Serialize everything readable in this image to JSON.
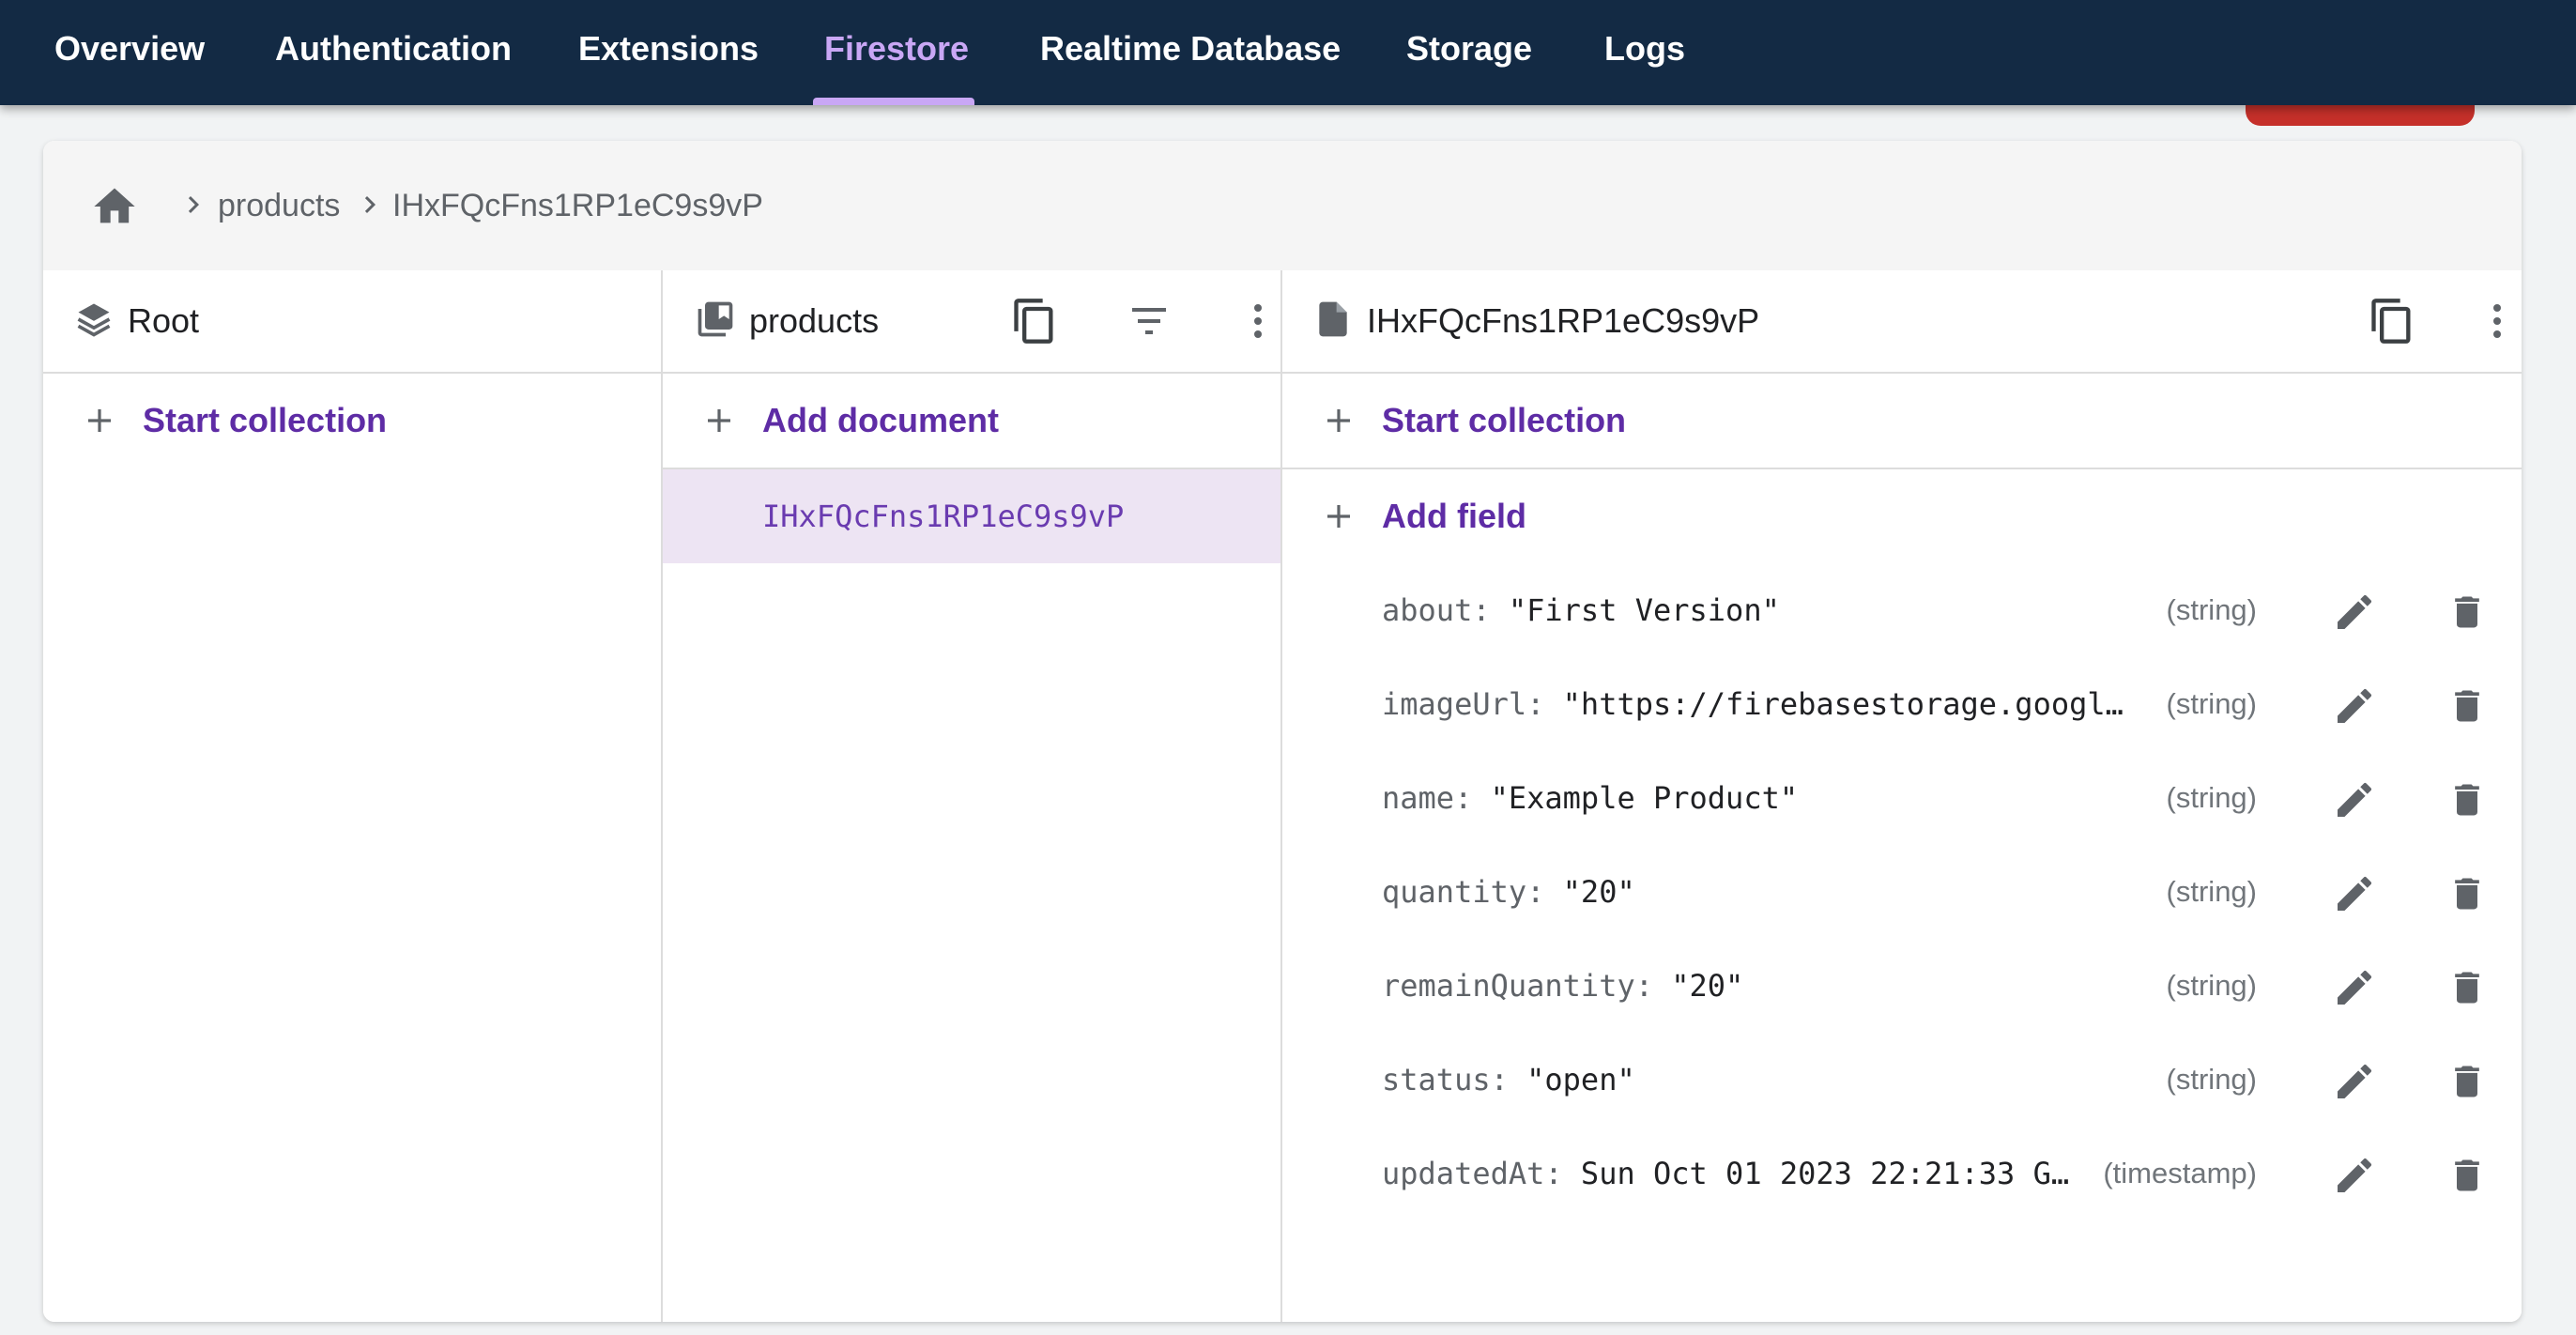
{
  "nav": {
    "tabs": [
      "Overview",
      "Authentication",
      "Extensions",
      "Firestore",
      "Realtime Database",
      "Storage",
      "Logs"
    ],
    "active": "Firestore"
  },
  "breadcrumb": {
    "items": [
      "products",
      "IHxFQcFns1RP1eC9s9vP"
    ]
  },
  "root_column": {
    "title": "Root",
    "start_collection_label": "Start collection"
  },
  "collection_column": {
    "title": "products",
    "add_document_label": "Add document",
    "documents": [
      "IHxFQcFns1RP1eC9s9vP"
    ]
  },
  "document_column": {
    "title": "IHxFQcFns1RP1eC9s9vP",
    "start_collection_label": "Start collection",
    "add_field_label": "Add field",
    "fields": [
      {
        "key": "about:",
        "value": "\"First Version\"",
        "type": "(string)"
      },
      {
        "key": "imageUrl:",
        "value": "\"https://firebasestorage.googl…",
        "type": "(string)"
      },
      {
        "key": "name:",
        "value": "\"Example Product\"",
        "type": "(string)"
      },
      {
        "key": "quantity:",
        "value": "\"20\"",
        "type": "(string)"
      },
      {
        "key": "remainQuantity:",
        "value": "\"20\"",
        "type": "(string)"
      },
      {
        "key": "status:",
        "value": "\"open\"",
        "type": "(string)"
      },
      {
        "key": "updatedAt:",
        "value": "Sun Oct 01 2023 22:21:33 G…",
        "type": "(timestamp)"
      }
    ]
  },
  "colors": {
    "nav_bg": "#132a44",
    "nav_active": "#c9a7f5",
    "accent_purple": "#5e2ca5",
    "selected_row": "#ede4f3",
    "danger_red": "#c5302a"
  },
  "icons": [
    "home-icon",
    "chevron-right-icon",
    "stack-icon",
    "collection-icon",
    "document-icon",
    "copy-icon",
    "filter-icon",
    "more-vert-icon",
    "plus-icon",
    "pencil-icon",
    "trash-icon"
  ]
}
